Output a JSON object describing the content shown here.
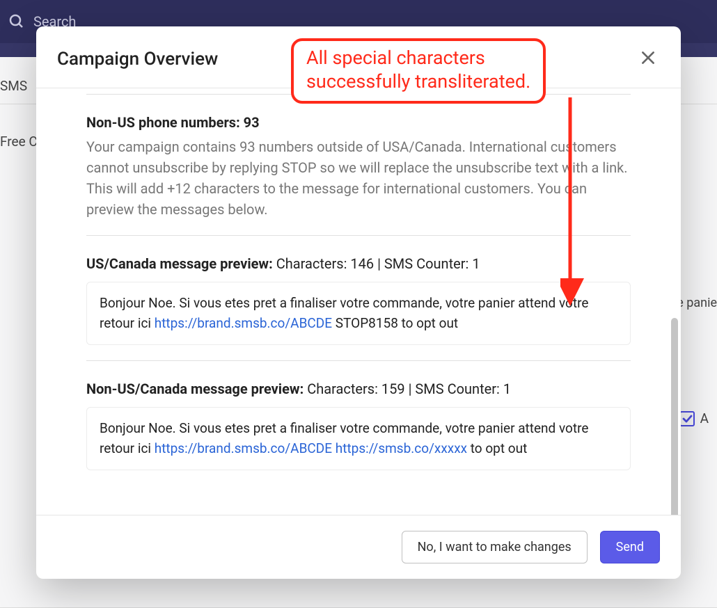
{
  "topbar": {
    "search_placeholder": "Search"
  },
  "background": {
    "sidebar_item_1": "SMS",
    "sidebar_item_2": "Free C",
    "right_text": "e panie",
    "check_label": "A"
  },
  "modal": {
    "title": "Campaign Overview",
    "non_us_heading": "Non-US phone numbers: 93",
    "non_us_text": "Your campaign contains 93 numbers outside of USA/Canada. International customers cannot unsubscribe by replying STOP so we will replace the unsubscribe text with a link. This will add +12 characters to the message for international customers. You can preview the messages below.",
    "us_preview_heading": "US/Canada message preview:",
    "us_preview_meta": " Characters: 146 | SMS Counter: 1",
    "us_preview_text_1": "Bonjour Noe. Si vous etes pret a finaliser votre commande, votre panier attend votre retour ici ",
    "us_preview_link_1": "https://brand.smsb.co/ABCDE",
    "us_preview_text_2": " STOP8158 to opt out",
    "non_us_preview_heading": "Non-US/Canada message preview:",
    "non_us_preview_meta": " Characters: 159 | SMS Counter: 1",
    "non_us_preview_text_1": "Bonjour Noe. Si vous etes pret a finaliser votre commande, votre panier attend votre retour ici ",
    "non_us_preview_link_1": "https://brand.smsb.co/ABCDE",
    "non_us_preview_link_2": "https://smsb.co/xxxxx",
    "non_us_preview_text_2": " to opt out",
    "footer": {
      "cancel": "No, I want to make changes",
      "send": "Send"
    }
  },
  "annotation": {
    "line1": "All special characters",
    "line2": "successfully transliterated."
  }
}
